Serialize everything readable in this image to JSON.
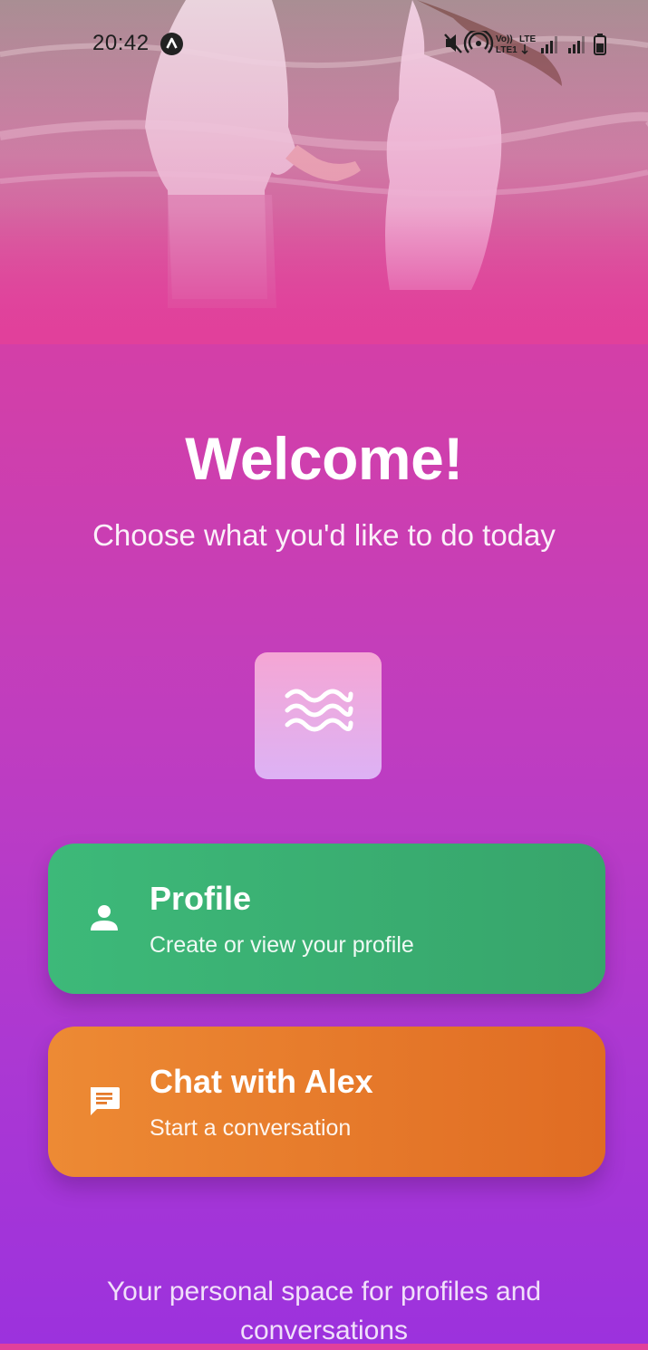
{
  "status_bar": {
    "time": "20:42",
    "app_icon": "app-notification-icon",
    "icons": [
      "mute-icon",
      "hotspot-icon",
      "volte-lte-icon",
      "signal-icon",
      "signal-icon",
      "battery-icon"
    ],
    "volte_label": "Vo)) LTE",
    "lte_label": "LTE1"
  },
  "welcome": {
    "title": "Welcome!",
    "subtitle": "Choose what you'd like to do today"
  },
  "logo": {
    "icon": "waves-icon"
  },
  "actions": {
    "profile": {
      "icon": "person-icon",
      "title": "Profile",
      "subtitle": "Create or view your profile",
      "color": "#3db979"
    },
    "chat": {
      "icon": "chat-icon",
      "title": "Chat with Alex",
      "subtitle": "Start a conversation",
      "color": "#ed8a34"
    }
  },
  "footer": {
    "text": "Your personal space for profiles and conversations"
  },
  "colors": {
    "background_top": "#e1409b",
    "background_bottom": "#9c32dd"
  }
}
